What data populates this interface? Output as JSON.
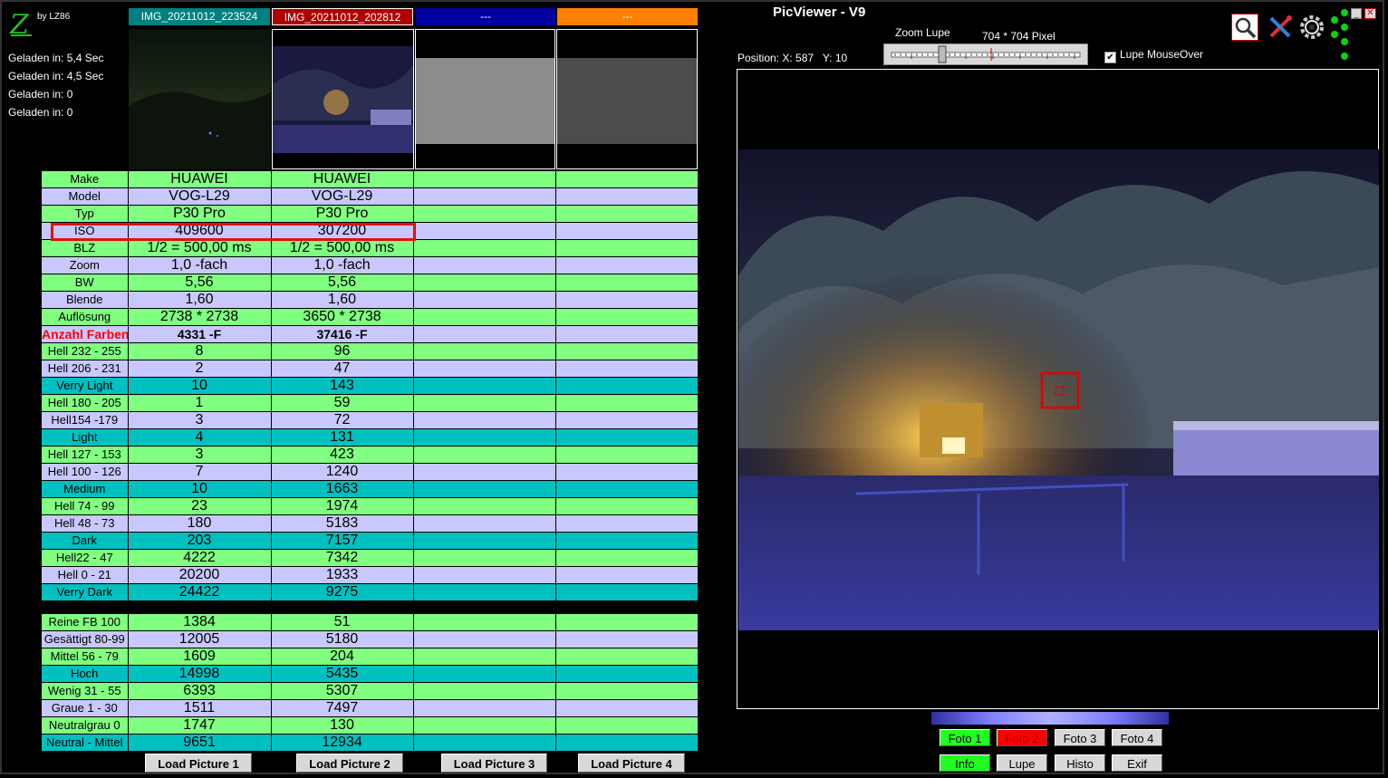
{
  "app": {
    "title": "PicViewer - V9",
    "byline": "by LZ86",
    "logo_letter": "Z"
  },
  "loaded": [
    "Geladen in: 5,4 Sec",
    "Geladen in: 4,5 Sec",
    "Geladen in: 0",
    "Geladen in: 0"
  ],
  "pictures": [
    {
      "name": "IMG_20211012_223524",
      "color": "#008080"
    },
    {
      "name": "IMG_20211012_202812",
      "color": "#b00000"
    },
    {
      "name": "---",
      "color": "#0000a0"
    },
    {
      "name": "---",
      "color": "#ff8000"
    }
  ],
  "table": {
    "rows": [
      {
        "label": "Make",
        "v1": "HUAWEI",
        "v2": "HUAWEI",
        "v3": "",
        "v4": "",
        "style": "g"
      },
      {
        "label": "Model",
        "v1": "VOG-L29",
        "v2": "VOG-L29",
        "v3": "",
        "v4": "",
        "style": "l"
      },
      {
        "label": "Typ",
        "v1": "P30 Pro",
        "v2": "P30 Pro",
        "v3": "",
        "v4": "",
        "style": "g"
      },
      {
        "label": "ISO",
        "v1": "409600",
        "v2": "307200",
        "v3": "",
        "v4": "",
        "style": "l"
      },
      {
        "label": "BLZ",
        "v1": "1/2 = 500,00 ms",
        "v2": "1/2 = 500,00 ms",
        "v3": "",
        "v4": "",
        "style": "g"
      },
      {
        "label": "Zoom",
        "v1": "1,0 -fach",
        "v2": "1,0 -fach",
        "v3": "",
        "v4": "",
        "style": "l"
      },
      {
        "label": "BW",
        "v1": "5,56",
        "v2": "5,56",
        "v3": "",
        "v4": "",
        "style": "g"
      },
      {
        "label": "Blende",
        "v1": "1,60",
        "v2": "1,60",
        "v3": "",
        "v4": "",
        "style": "l"
      },
      {
        "label": "Auflösung",
        "v1": "2738 * 2738",
        "v2": "3650 * 2738",
        "v3": "",
        "v4": "",
        "style": "g"
      },
      {
        "label": "Anzahl Farben",
        "v1": "4331 -F",
        "v2": "37416 -F",
        "v3": "",
        "v4": "",
        "style": "l colors"
      },
      {
        "label": "Hell 232 - 255",
        "v1": "8",
        "v2": "96",
        "v3": "",
        "v4": "",
        "style": "g"
      },
      {
        "label": "Hell 206 - 231",
        "v1": "2",
        "v2": "47",
        "v3": "",
        "v4": "",
        "style": "l"
      },
      {
        "label": "Verry Light",
        "v1": "10",
        "v2": "143",
        "v3": "",
        "v4": "",
        "style": "c"
      },
      {
        "label": "Hell 180 - 205",
        "v1": "1",
        "v2": "59",
        "v3": "",
        "v4": "",
        "style": "g"
      },
      {
        "label": "Hell154 -179",
        "v1": "3",
        "v2": "72",
        "v3": "",
        "v4": "",
        "style": "l"
      },
      {
        "label": "Light",
        "v1": "4",
        "v2": "131",
        "v3": "",
        "v4": "",
        "style": "c"
      },
      {
        "label": "Hell 127 - 153",
        "v1": "3",
        "v2": "423",
        "v3": "",
        "v4": "",
        "style": "g"
      },
      {
        "label": "Hell 100 - 126",
        "v1": "7",
        "v2": "1240",
        "v3": "",
        "v4": "",
        "style": "l"
      },
      {
        "label": "Medium",
        "v1": "10",
        "v2": "1663",
        "v3": "",
        "v4": "",
        "style": "c"
      },
      {
        "label": "Hell 74 - 99",
        "v1": "23",
        "v2": "1974",
        "v3": "",
        "v4": "",
        "style": "g"
      },
      {
        "label": "Hell 48 - 73",
        "v1": "180",
        "v2": "5183",
        "v3": "",
        "v4": "",
        "style": "l"
      },
      {
        "label": "Dark",
        "v1": "203",
        "v2": "7157",
        "v3": "",
        "v4": "",
        "style": "c"
      },
      {
        "label": "Hell22 - 47",
        "v1": "4222",
        "v2": "7342",
        "v3": "",
        "v4": "",
        "style": "g"
      },
      {
        "label": "Hell 0 - 21",
        "v1": "20200",
        "v2": "1933",
        "v3": "",
        "v4": "",
        "style": "l"
      },
      {
        "label": "Verry Dark",
        "v1": "24422",
        "v2": "9275",
        "v3": "",
        "v4": "",
        "style": "c"
      },
      {
        "label": "",
        "v1": "",
        "v2": "",
        "v3": "",
        "v4": "",
        "style": "sep"
      },
      {
        "label": "Reine FB 100",
        "v1": "1384",
        "v2": "51",
        "v3": "",
        "v4": "",
        "style": "g"
      },
      {
        "label": "Gesättigt 80-99",
        "v1": "12005",
        "v2": "5180",
        "v3": "",
        "v4": "",
        "style": "l"
      },
      {
        "label": "Mittel 56 - 79",
        "v1": "1609",
        "v2": "204",
        "v3": "",
        "v4": "",
        "style": "g"
      },
      {
        "label": "Hoch",
        "v1": "14998",
        "v2": "5435",
        "v3": "",
        "v4": "",
        "style": "c"
      },
      {
        "label": "Wenig 31 - 55",
        "v1": "6393",
        "v2": "5307",
        "v3": "",
        "v4": "",
        "style": "g"
      },
      {
        "label": "Graue 1 - 30",
        "v1": "1511",
        "v2": "7497",
        "v3": "",
        "v4": "",
        "style": "l"
      },
      {
        "label": "Neutralgrau 0",
        "v1": "1747",
        "v2": "130",
        "v3": "",
        "v4": "",
        "style": "g"
      },
      {
        "label": "Neutral - Mittel",
        "v1": "9651",
        "v2": "12934",
        "v3": "",
        "v4": "",
        "style": "c"
      }
    ]
  },
  "load_buttons": [
    "Load Picture 1",
    "Load Picture 2",
    "Load Picture 3",
    "Load Picture 4"
  ],
  "viewer": {
    "position_label": "Position: X: 587   Y: 10",
    "zoom_label": "Zoom Lupe",
    "pixel_label": "704 * 704 Pixel",
    "lupe_mouseover_label": "Lupe MouseOver",
    "lupe_mouseover_checked": "✔"
  },
  "foto_buttons": [
    {
      "label": "Foto 1",
      "bg": "#20ff20",
      "fg": "#000000"
    },
    {
      "label": "Foto 2",
      "bg": "#ff0000",
      "fg": "#b00000"
    },
    {
      "label": "Foto 3",
      "bg": "#d8d8d8",
      "fg": "#000000"
    },
    {
      "label": "Foto 4",
      "bg": "#d8d8d8",
      "fg": "#000000"
    }
  ],
  "mode_buttons": [
    {
      "label": "Info",
      "bg": "#20ff20"
    },
    {
      "label": "Lupe",
      "bg": "#d8d8d8"
    },
    {
      "label": "Histo",
      "bg": "#d8d8d8"
    },
    {
      "label": "Exif",
      "bg": "#d8d8d8"
    }
  ],
  "icons": [
    "magnifier-icon",
    "tools-icon",
    "settings-gear-icon"
  ],
  "window_controls": [
    "minimize-icon",
    "close-icon"
  ]
}
